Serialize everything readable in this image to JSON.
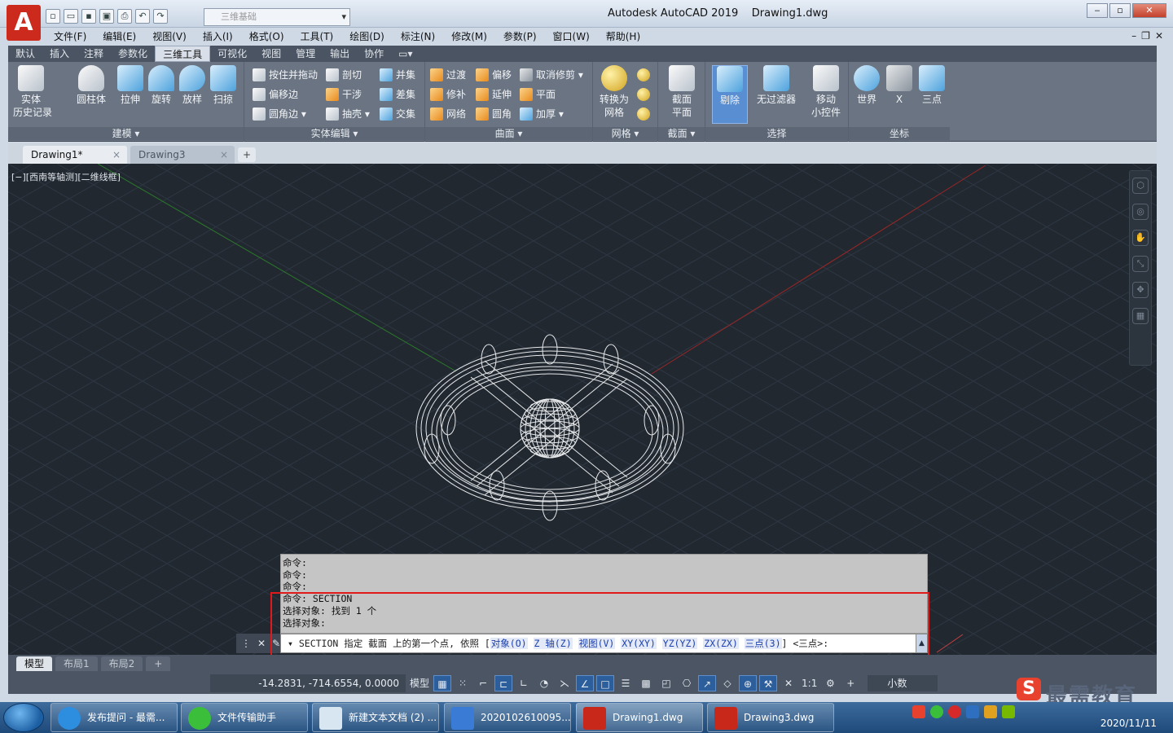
{
  "window": {
    "title": "Autodesk AutoCAD 2019",
    "document": "Drawing1.dwg",
    "logo": "A"
  },
  "qat": {
    "workspace": "三维基础",
    "icons": [
      "new-icon",
      "open-icon",
      "save-icon",
      "saveas-icon",
      "plot-icon",
      "undo-icon",
      "redo-icon"
    ]
  },
  "menubar": [
    "文件(F)",
    "编辑(E)",
    "视图(V)",
    "插入(I)",
    "格式(O)",
    "工具(T)",
    "绘图(D)",
    "标注(N)",
    "修改(M)",
    "参数(P)",
    "窗口(W)",
    "帮助(H)"
  ],
  "ribbon_tabs": [
    "默认",
    "插入",
    "注释",
    "参数化",
    "三维工具",
    "可视化",
    "视图",
    "管理",
    "输出",
    "协作"
  ],
  "ribbon_tab_active": "三维工具",
  "ribbon": {
    "modeling": {
      "title": "建模 ▾",
      "btns": [
        "实体\n历史记录",
        "圆柱体",
        "拉伸",
        "旋转",
        "放样",
        "扫掠"
      ]
    },
    "solid_edit": {
      "title": "实体编辑 ▾",
      "btns": [
        "按住并拖动",
        "剖切",
        "并集",
        "偏移边",
        "干涉",
        "差集",
        "圆角边 ▾",
        "抽壳 ▾",
        "交集"
      ]
    },
    "surface": {
      "title": "曲面 ▾",
      "btns": [
        "过渡",
        "偏移",
        "取消修剪 ▾",
        "修补",
        "延伸",
        "平面",
        "网络",
        "圆角",
        "加厚 ▾"
      ]
    },
    "mesh": {
      "title": "网格 ▾",
      "btns": [
        "转换为\n网格"
      ]
    },
    "section": {
      "title": "截面 ▾",
      "btns": [
        "截面\n平面"
      ]
    },
    "selection": {
      "title": "选择",
      "btns": [
        "剔除",
        "无过滤器",
        "移动\n小控件"
      ]
    },
    "coords": {
      "title": "坐标",
      "btns": [
        "世界",
        "X",
        "三点"
      ]
    }
  },
  "doc_tabs": [
    {
      "label": "Drawing1*",
      "active": true
    },
    {
      "label": "Drawing3",
      "active": false
    }
  ],
  "viewport": {
    "label": "[−][西南等轴测][二维线框]"
  },
  "command": {
    "history": [
      "命令:",
      "命令:",
      "命令:",
      "命令: SECTION",
      "选择对象: 找到 1 个",
      "选择对象:"
    ],
    "prompt_head": "SECTION 指定 截面 上的第一个点, 依照 [",
    "options": [
      "对象(O)",
      "Z 轴(Z)",
      "视图(V)",
      "XY(XY)",
      "YZ(YZ)",
      "ZX(ZX)",
      "三点(3)"
    ],
    "prompt_tail": "] <三点>:"
  },
  "layout_tabs": [
    "模型",
    "布局1",
    "布局2"
  ],
  "status": {
    "coords": "-14.2831, -714.6554, 0.0000",
    "model": "模型",
    "scale": "1:1",
    "units": "小数"
  },
  "watermark": {
    "text": "最需教育",
    "logo": "S"
  },
  "taskbar": {
    "items": [
      "发布提问 - 最需...",
      "文件传输助手",
      "新建文本文档 (2) ...",
      "2020102610095...",
      "Drawing1.dwg",
      "Drawing3.dwg"
    ],
    "time": "2020/11/11",
    "ime": "英"
  },
  "colors": {
    "accent": "#2c5e9b",
    "highlight": "#e0191b",
    "viewport_bg": "#212830"
  }
}
